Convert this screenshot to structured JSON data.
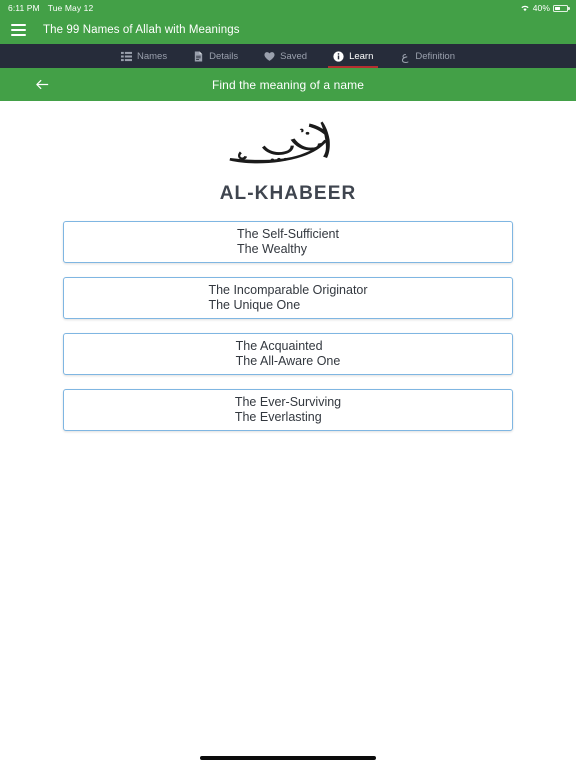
{
  "status_bar": {
    "time": "6:11 PM",
    "date": "Tue May 12",
    "battery_percent": "40%",
    "wifi_icon": "wifi-icon",
    "battery_icon": "battery-icon"
  },
  "app_bar": {
    "menu_icon": "hamburger-menu-icon",
    "title": "The 99 Names of Allah with Meanings",
    "background_color": "#43a047"
  },
  "tabs": [
    {
      "label": "Names",
      "icon": "list-icon",
      "active": false
    },
    {
      "label": "Details",
      "icon": "document-icon",
      "active": false
    },
    {
      "label": "Saved",
      "icon": "heart-icon",
      "active": false
    },
    {
      "label": "Learn",
      "icon": "info-icon",
      "active": true
    },
    {
      "label": "Definition",
      "icon": "arabic-letter-icon",
      "glyph": "ع",
      "active": false
    }
  ],
  "tab_bar": {
    "background_color": "#262c3a",
    "active_indicator_color": "#b53030"
  },
  "sub_header": {
    "back_icon": "back-arrow-icon",
    "title": "Find the meaning of a name"
  },
  "question": {
    "arabic_calligraphy": "الخبير",
    "name": "AL-KHABEER"
  },
  "options": [
    {
      "line1": "The Self-Sufficient",
      "line2": "The Wealthy"
    },
    {
      "line1": "The Incomparable Originator",
      "line2": "The Unique One"
    },
    {
      "line1": "The Acquainted",
      "line2": "The All-Aware One"
    },
    {
      "line1": "The Ever-Surviving",
      "line2": "The Everlasting"
    }
  ],
  "option_style": {
    "border_color": "#7fb6e2"
  }
}
